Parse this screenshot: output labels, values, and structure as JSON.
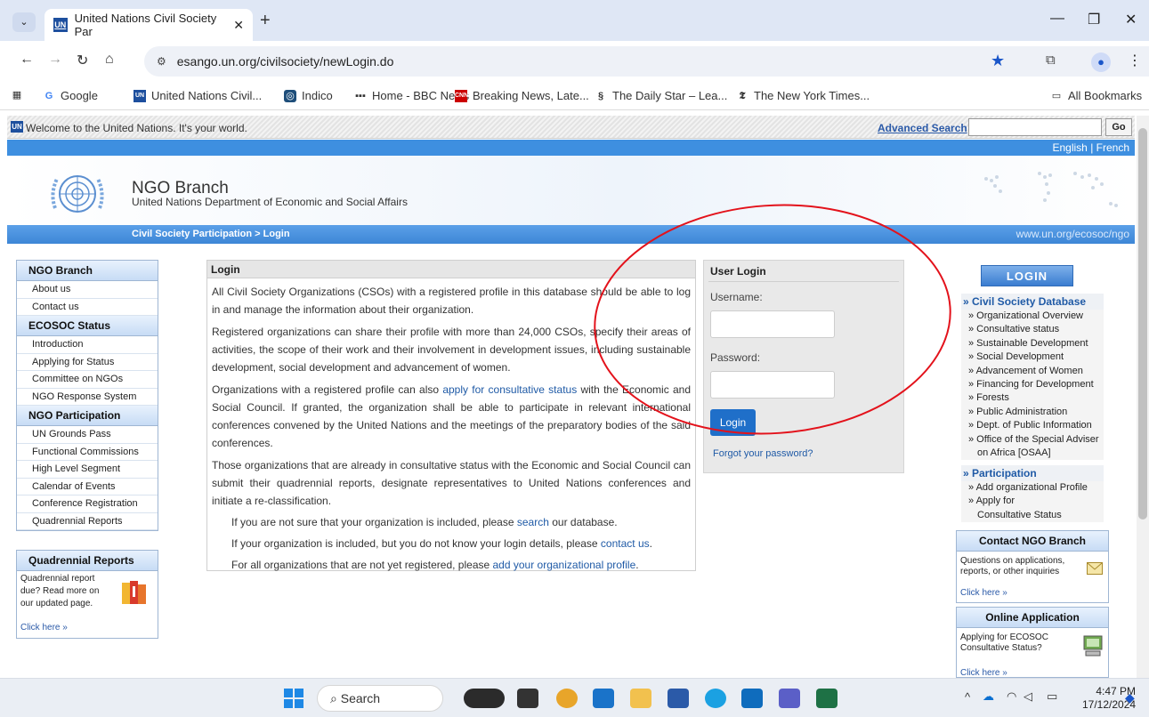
{
  "browser": {
    "tab_title": "United Nations Civil Society Par",
    "url": "esango.un.org/civilsociety/newLogin.do",
    "bookmarks": [
      "Google",
      "United Nations Civil...",
      "Indico",
      "Home - BBC News",
      "Breaking News, Late...",
      "The Daily Star – Lea...",
      "The New York Times..."
    ],
    "all_bookmarks": "All Bookmarks"
  },
  "site": {
    "welcome": "Welcome to the United Nations. It's your world.",
    "advanced_search": "Advanced Search",
    "go": "Go",
    "lang": "English | French",
    "title": "NGO Branch",
    "subtitle": "United Nations Department of Economic and Social Affairs",
    "breadcrumb": "Civil Society Participation > Login",
    "site_url": "www.un.org/ecosoc/ngo"
  },
  "leftnav": {
    "ngo_branch": "NGO Branch",
    "ngo_items": [
      "About us",
      "Contact us"
    ],
    "ecosoc": "ECOSOC Status",
    "ecosoc_items": [
      "Introduction",
      "Applying for Status",
      "Committee on NGOs",
      "NGO Response System"
    ],
    "participation": "NGO Participation",
    "participation_items": [
      "UN Grounds Pass",
      "Functional Commissions",
      "High Level Segment",
      "Calendar of Events",
      "Conference Registration",
      "Quadrennial Reports"
    ],
    "quad_title": "Quadrennial Reports",
    "quad_text": "Quadrennial report due? Read more on our updated page.",
    "quad_link": "Click here »"
  },
  "main": {
    "heading": "Login",
    "p1": "All Civil Society Organizations (CSOs) with a registered profile in this database should be able to log in and manage the information about their organization.",
    "p2": "Registered organizations can share their profile with more than 24,000 CSOs, specify their areas of activities, the scope of their work and their involvement in development issues, including sustainable development, social development and advancement of women.",
    "p3_pre": "Organizations with a registered profile can also ",
    "p3_link": "apply for consultative status",
    "p3_post": " with the Economic and Social Council. If granted, the organization shall be able to participate in relevant international conferences convened by the United Nations and the meetings of the preparatory bodies of the said conferences.",
    "p4": "Those organizations that are already in consultative status with the Economic and Social Council can submit their quadrennial reports, designate representatives to United Nations conferences and initiate a re-classification.",
    "p5_pre": "If you are not sure that your organization is included, please ",
    "p5_link": "search",
    "p5_post": " our database.",
    "p6_pre": "If your organization is included, but you do not know your login details, please ",
    "p6_link": "contact us",
    "p6_post": ".",
    "p7_pre": "For all organizations that are not yet registered, please ",
    "p7_link": "add your organizational profile",
    "p7_post": "."
  },
  "login": {
    "heading": "User Login",
    "username_label": "Username:",
    "password_label": "Password:",
    "button": "Login",
    "forgot": "Forgot your password?"
  },
  "right": {
    "badge": "LOGIN",
    "db_head": "» Civil Society Database",
    "db_items": [
      "» Organizational Overview",
      "» Consultative status",
      "» Sustainable Development",
      "» Social Development",
      "» Advancement of Women",
      "» Financing for Development",
      "» Forests",
      "» Public Administration",
      "» Dept. of Public Information",
      "» Office of the Special Adviser"
    ],
    "db_items_cont": "on Africa [OSAA]",
    "part_head": "» Participation",
    "part_items": [
      "» Add organizational Profile",
      "» Apply for"
    ],
    "part_cont": "Consultative Status",
    "contact_head": "Contact NGO Branch",
    "contact_text": "Questions on applications, reports, or other inquiries",
    "contact_link": "Click here »",
    "online_head": "Online Application",
    "online_text": "Applying for ECOSOC Consultative Status?",
    "online_link": "Click here »"
  },
  "taskbar": {
    "search": "Search",
    "time": "4:47 PM",
    "date": "17/12/2024"
  }
}
